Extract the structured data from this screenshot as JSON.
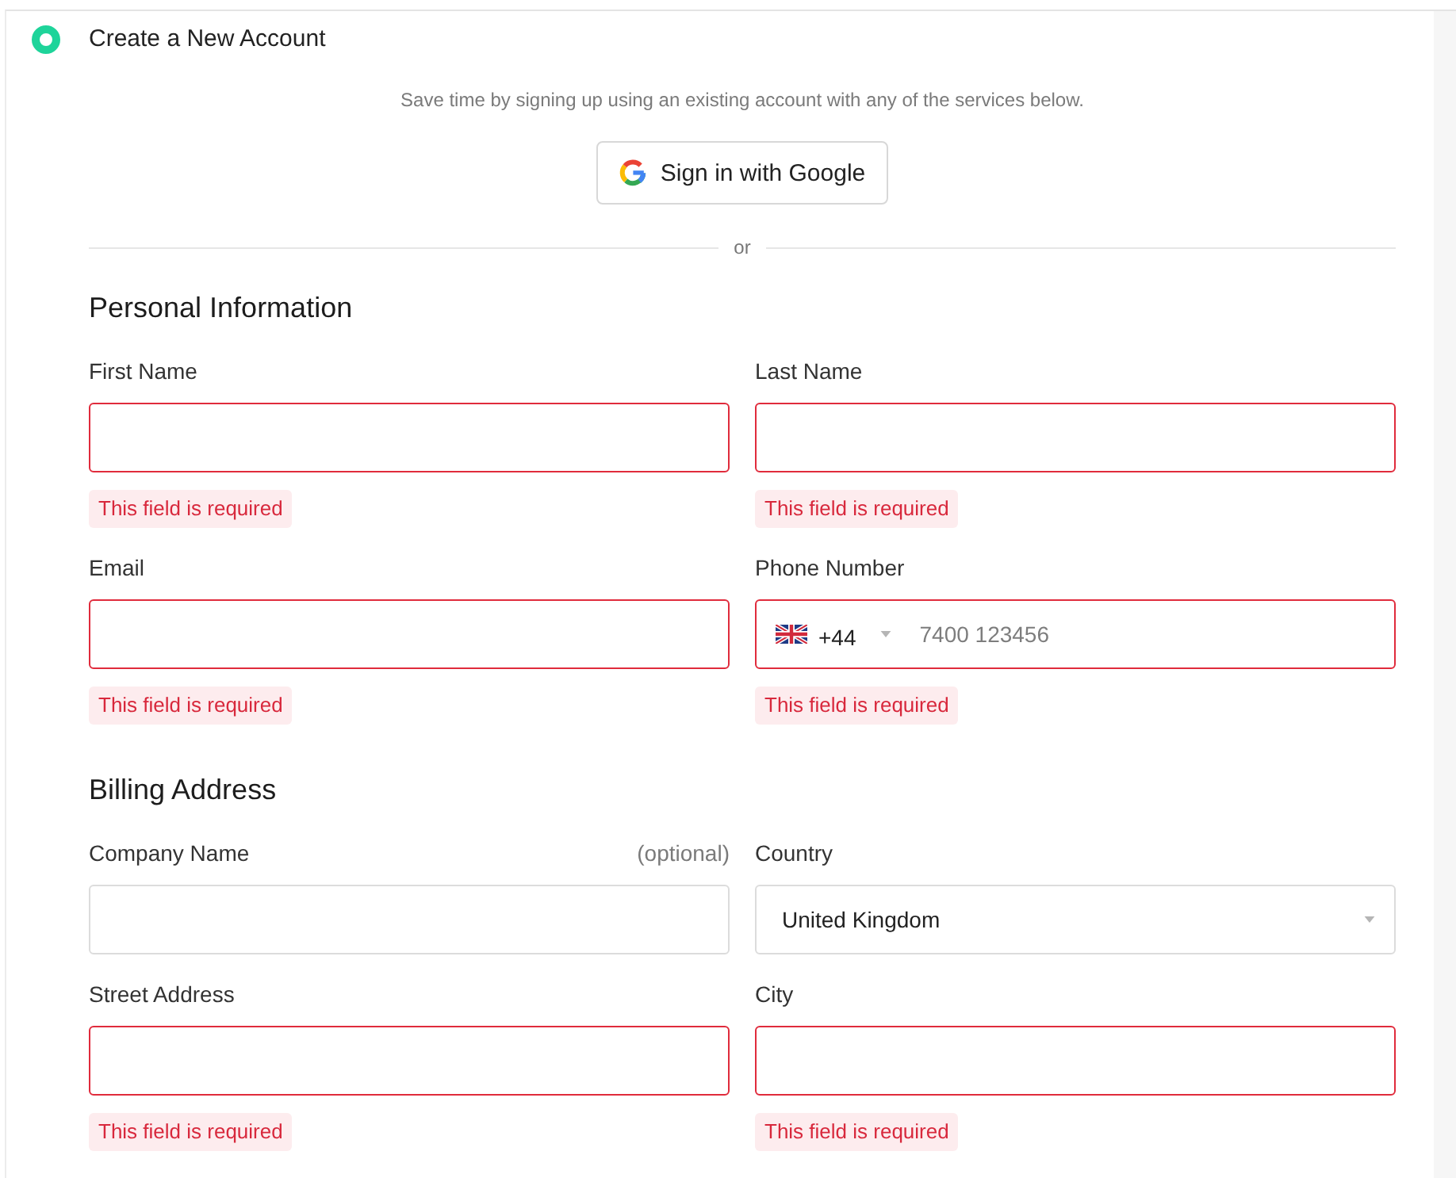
{
  "step": {
    "title": "Create a New Account",
    "active": true
  },
  "social": {
    "intro": "Save time by signing up using an existing account with any of the services below.",
    "button": "Sign in with Google",
    "separator": "or"
  },
  "sections": [
    {
      "heading": "Personal Information",
      "fields": [
        {
          "kind": "text",
          "label": "First Name",
          "invalid": true,
          "error": "This field is required"
        },
        {
          "kind": "text",
          "label": "Last Name",
          "invalid": true,
          "error": "This field is required"
        },
        {
          "kind": "text",
          "label": "Email",
          "invalid": true,
          "error": "This field is required"
        },
        {
          "kind": "phone",
          "label": "Phone Number",
          "dial_code": "+44",
          "placeholder": "7400 123456",
          "invalid": true,
          "error": "This field is required"
        }
      ]
    },
    {
      "heading": "Billing Address",
      "fields": [
        {
          "kind": "text",
          "label": "Company Name",
          "hint": "(optional)",
          "invalid": false
        },
        {
          "kind": "select",
          "label": "Country",
          "value": "United Kingdom",
          "invalid": false
        },
        {
          "kind": "text",
          "label": "Street Address",
          "invalid": true,
          "error": "This field is required"
        },
        {
          "kind": "text",
          "label": "City",
          "invalid": true,
          "error": "This field is required"
        }
      ]
    }
  ]
}
